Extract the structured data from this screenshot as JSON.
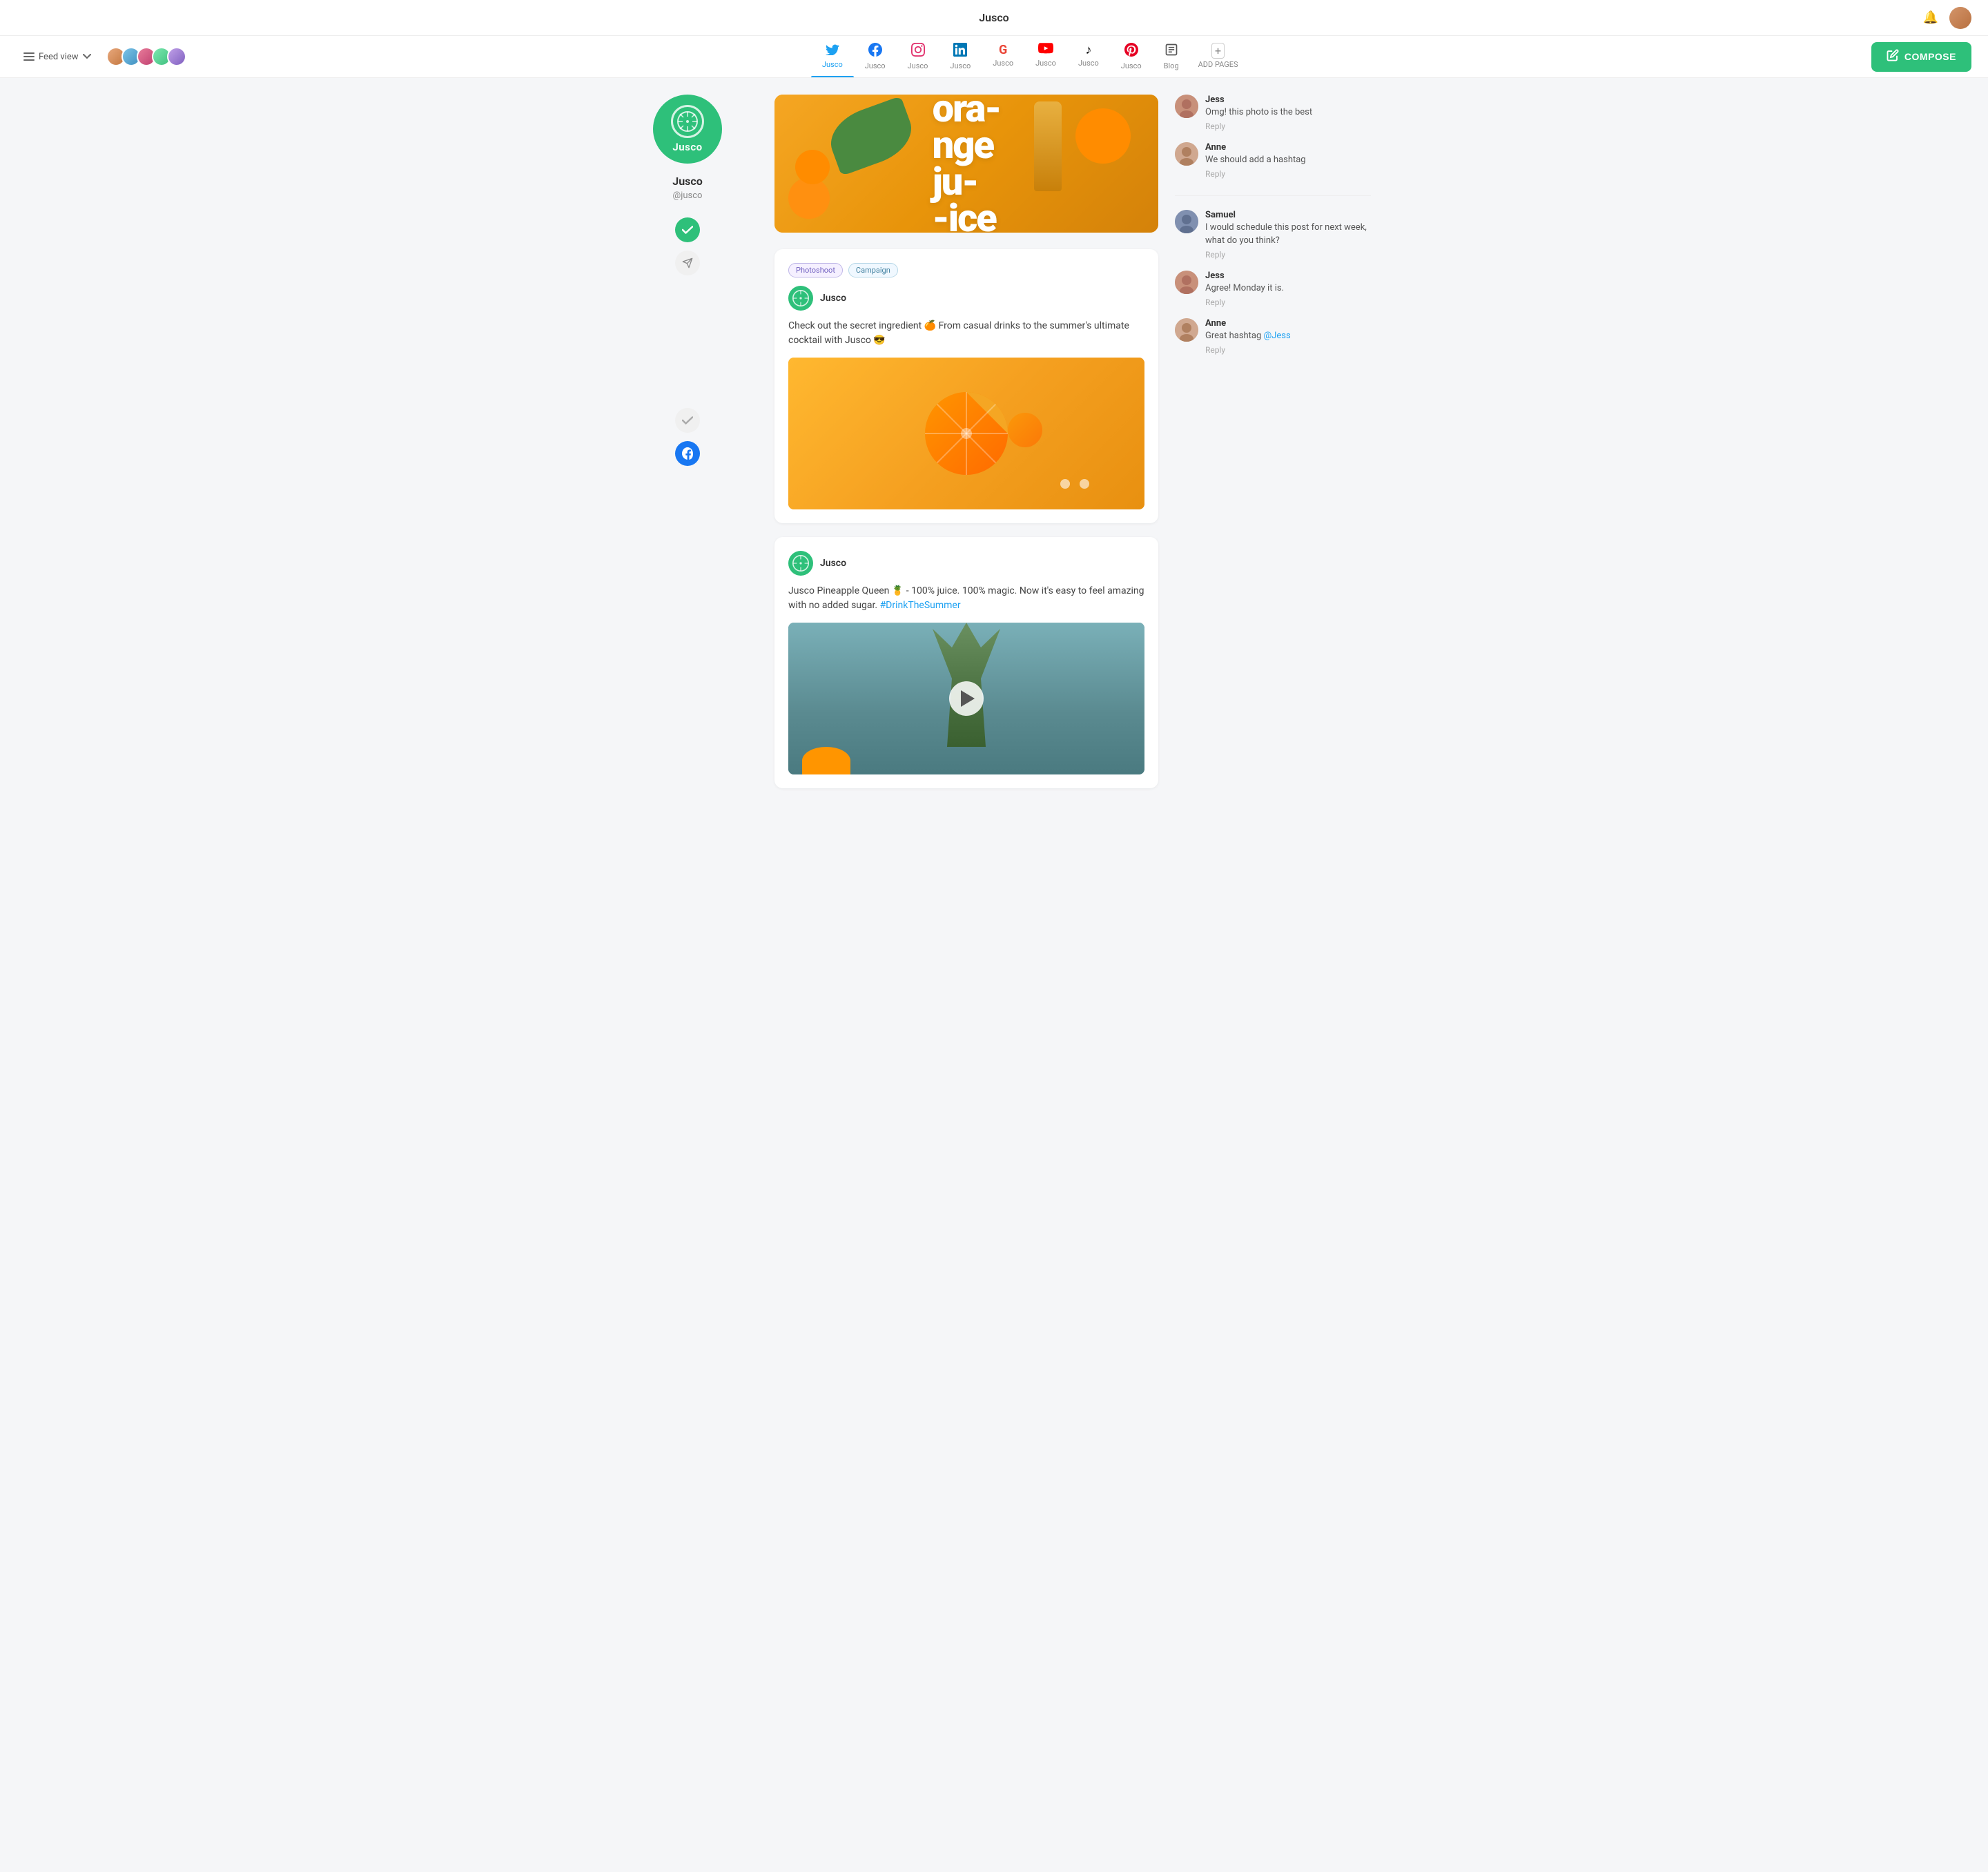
{
  "app": {
    "title": "Jusco",
    "notification_icon": "🔔"
  },
  "nav": {
    "feed_view_label": "Feed view",
    "tabs": [
      {
        "id": "twitter",
        "label": "Jusco",
        "icon": "twitter",
        "active": true
      },
      {
        "id": "facebook",
        "label": "Jusco",
        "icon": "facebook",
        "active": false
      },
      {
        "id": "instagram",
        "label": "Jusco",
        "icon": "instagram",
        "active": false
      },
      {
        "id": "linkedin",
        "label": "Jusco",
        "icon": "linkedin",
        "active": false
      },
      {
        "id": "google",
        "label": "Jusco",
        "icon": "google",
        "active": false
      },
      {
        "id": "youtube",
        "label": "Jusco",
        "icon": "youtube",
        "active": false
      },
      {
        "id": "tiktok",
        "label": "Jusco",
        "icon": "tiktok",
        "active": false
      },
      {
        "id": "pinterest",
        "label": "Jusco",
        "icon": "pinterest",
        "active": false
      },
      {
        "id": "blog",
        "label": "Blog",
        "icon": "blog",
        "active": false
      }
    ],
    "add_pages_label": "ADD PAGES",
    "compose_label": "COMPOSE"
  },
  "sidebar": {
    "profile_name": "Jusco",
    "profile_handle": "@jusco",
    "logo_text": "Jusco"
  },
  "hero": {
    "text": "ora-nge ju--ice"
  },
  "posts": [
    {
      "id": "post1",
      "tags": [
        "Photoshoot",
        "Campaign"
      ],
      "author": "Jusco",
      "text": "Check out the secret ingredient 🍊 From casual drinks to the summer's ultimate cocktail with Jusco 😎",
      "image_type": "orange"
    },
    {
      "id": "post2",
      "tags": [],
      "author": "Jusco",
      "text_parts": [
        {
          "type": "text",
          "content": "Jusco Pineapple Queen 🍍 - 100% juice. 100% magic. Now it's easy to feel amazing with no added sugar. "
        },
        {
          "type": "hashtag",
          "content": "#DrinkTheSummer"
        }
      ],
      "image_type": "pineapple"
    }
  ],
  "comments": {
    "post1": [
      {
        "author": "Jess",
        "avatar": "jess",
        "text": "Omg! this photo is the best",
        "reply_label": "Reply"
      },
      {
        "author": "Anne",
        "avatar": "anne",
        "text": "We should add a hashtag",
        "reply_label": "Reply"
      }
    ],
    "post2": [
      {
        "author": "Samuel",
        "avatar": "samuel",
        "text": "I would schedule this post for next week, what do you think?",
        "reply_label": "Reply"
      },
      {
        "author": "Jess",
        "avatar": "jess",
        "text": "Agree! Monday it is.",
        "reply_label": "Reply"
      },
      {
        "author": "Anne",
        "avatar": "anne",
        "text_parts": [
          {
            "type": "text",
            "content": "Great hashtag "
          },
          {
            "type": "mention",
            "content": "@Jess"
          }
        ],
        "reply_label": "Reply"
      }
    ]
  },
  "colors": {
    "brand_green": "#2ec07a",
    "twitter_blue": "#1da1f2",
    "orange": "#f5a623",
    "facebook_blue": "#1877f2"
  }
}
